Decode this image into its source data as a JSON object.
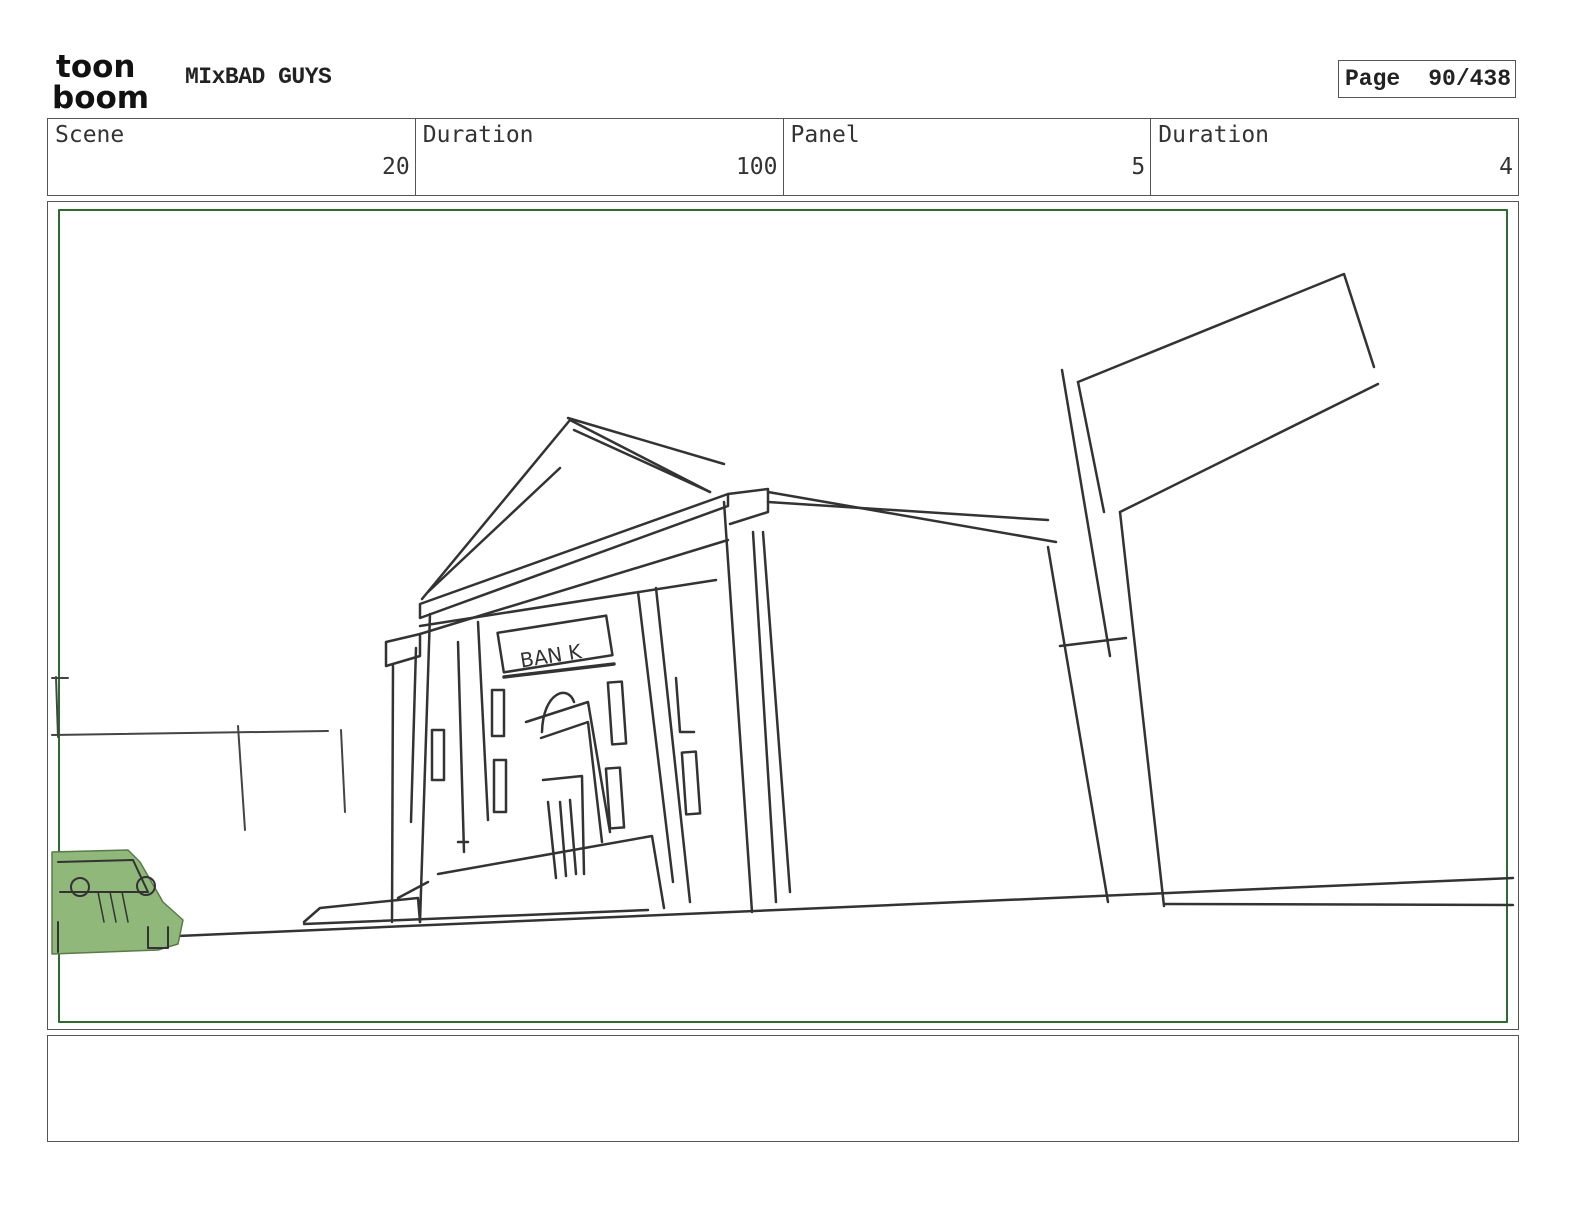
{
  "header": {
    "logo": {
      "line1": "toon",
      "line2": "boom"
    },
    "project_title": "MIxBAD GUYS",
    "page_label": "Page",
    "page_value": "90/438"
  },
  "info": {
    "scene_label": "Scene",
    "scene_value": "20",
    "scene_duration_label": "Duration",
    "scene_duration_value": "100",
    "panel_label": "Panel",
    "panel_value": "5",
    "panel_duration_label": "Duration",
    "panel_duration_value": "4"
  },
  "panel": {
    "sketch_sign_text": "BAN K",
    "safe_frame_color": "#2e6b2e",
    "car_fill_color": "#8fb87a"
  },
  "notes": {
    "text": ""
  }
}
